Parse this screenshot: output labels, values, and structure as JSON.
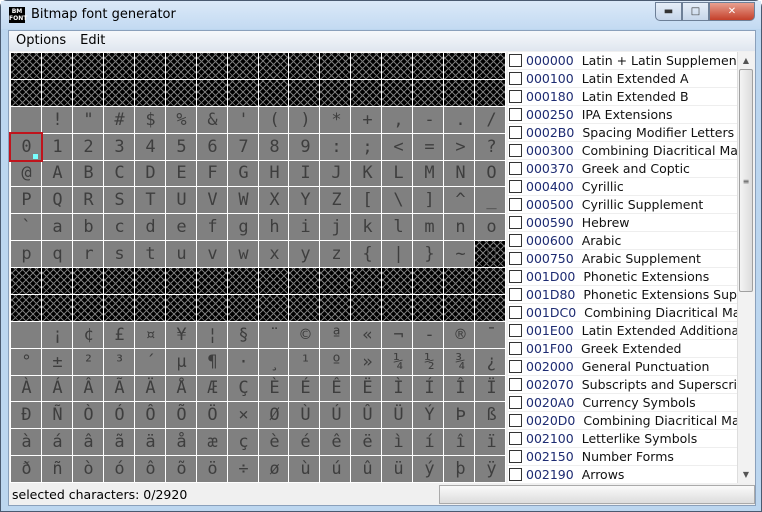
{
  "window": {
    "title": "Bitmap font generator",
    "icon_text": "BM FONT",
    "controls": [
      "minimize",
      "maximize",
      "close"
    ]
  },
  "menu": [
    "Options",
    "Edit"
  ],
  "grid": {
    "rows": [
      null,
      null,
      " !\"#$%&'()*+,-./",
      "0123456789:;<=>?",
      "@ABCDEFGHIJKLMNO",
      "PQRSTUVWXYZ[\\]^_",
      "`abcdefghijklmno",
      "pqrstuvwxyz{|}~\u0000",
      null,
      null,
      " ¡¢£¤¥¦§¨©ª«¬-®¯",
      "°±²³´µ¶·¸¹º»¼½¾¿",
      "ÀÁÂÃÄÅÆÇÈÉÊËÌÍÎÏ",
      "ÐÑÒÓÔÕÖ×ØÙÚÛÜÝÞß",
      "àáâãäåæçèéêëìíîï",
      "ðñòóôõö÷øùúûüýþÿ"
    ],
    "selected_char": "0",
    "selection_color": "#c0141c"
  },
  "ranges": [
    {
      "code": "000000",
      "name": "Latin + Latin Supplement"
    },
    {
      "code": "000100",
      "name": "Latin Extended A"
    },
    {
      "code": "000180",
      "name": "Latin Extended B"
    },
    {
      "code": "000250",
      "name": "IPA Extensions"
    },
    {
      "code": "0002B0",
      "name": "Spacing Modifier Letters"
    },
    {
      "code": "000300",
      "name": "Combining Diacritical Marks"
    },
    {
      "code": "000370",
      "name": "Greek and Coptic"
    },
    {
      "code": "000400",
      "name": "Cyrillic"
    },
    {
      "code": "000500",
      "name": "Cyrillic Supplement"
    },
    {
      "code": "000590",
      "name": "Hebrew"
    },
    {
      "code": "000600",
      "name": "Arabic"
    },
    {
      "code": "000750",
      "name": "Arabic Supplement"
    },
    {
      "code": "001D00",
      "name": "Phonetic Extensions"
    },
    {
      "code": "001D80",
      "name": "Phonetic Extensions Supple."
    },
    {
      "code": "001DC0",
      "name": "Combining Diacritical Marks"
    },
    {
      "code": "001E00",
      "name": "Latin Extended Additional"
    },
    {
      "code": "001F00",
      "name": "Greek Extended"
    },
    {
      "code": "002000",
      "name": "General Punctuation"
    },
    {
      "code": "002070",
      "name": "Subscripts and Superscripts"
    },
    {
      "code": "0020A0",
      "name": "Currency Symbols"
    },
    {
      "code": "0020D0",
      "name": "Combining Diacritical Marks"
    },
    {
      "code": "002100",
      "name": "Letterlike Symbols"
    },
    {
      "code": "002150",
      "name": "Number Forms"
    },
    {
      "code": "002190",
      "name": "Arrows"
    }
  ],
  "status": {
    "text": "selected characters: 0/2920"
  }
}
